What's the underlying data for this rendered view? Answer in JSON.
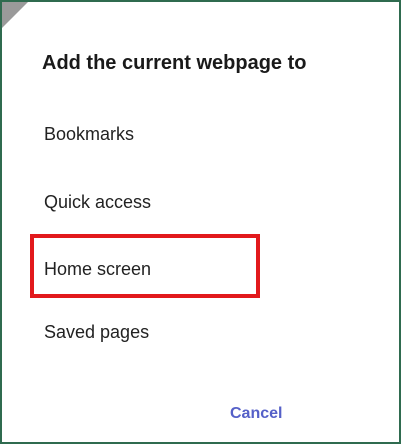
{
  "dialog": {
    "title": "Add the current webpage to",
    "options": [
      {
        "label": "Bookmarks"
      },
      {
        "label": "Quick access"
      },
      {
        "label": "Home screen"
      },
      {
        "label": "Saved pages"
      }
    ],
    "cancel_label": "Cancel"
  },
  "colors": {
    "frame_border": "#2f6b4f",
    "highlight": "#e2191c",
    "cancel_text": "#5560c8",
    "corner_shade": "#9a9a9a"
  }
}
